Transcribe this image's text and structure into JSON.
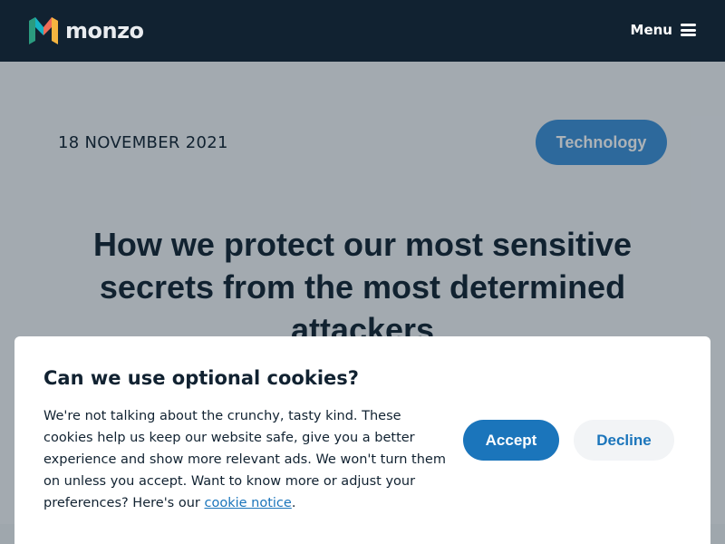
{
  "nav": {
    "logo_text": "monzo",
    "logo_icon": "monzo-m-logo",
    "menu_label": "Menu",
    "menu_icon": "hamburger-icon"
  },
  "article": {
    "date": "18 NOVEMBER 2021",
    "category": "Technology",
    "title": "How we protect our most sensitive secrets from the most determined attackers"
  },
  "cookie_banner": {
    "heading": "Can we use optional cookies?",
    "body_text": "We're not talking about the crunchy, tasty kind. These cookies help us keep our website safe, give you a better experience and show more relevant ads. We won't turn them on unless you accept. Want to know more or adjust your preferences? Here's our ",
    "link_text": "cookie notice",
    "body_end": ".",
    "accept_label": "Accept",
    "decline_label": "Decline"
  },
  "colors": {
    "nav_background": "#112231",
    "accent": "#1b75bb",
    "tag_background": "#3d8fd6",
    "text": "#112231"
  }
}
